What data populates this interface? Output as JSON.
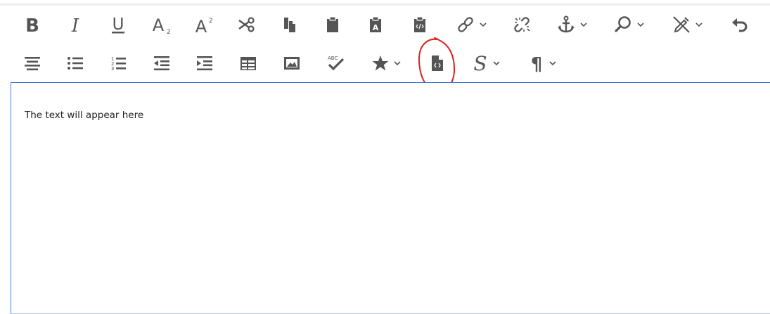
{
  "editor": {
    "content": "The text will appear here"
  },
  "toolbar": {
    "row1": [
      {
        "name": "bold-icon",
        "glyph": "B"
      },
      {
        "name": "italic-icon",
        "glyph": "I"
      },
      {
        "name": "underline-icon",
        "glyph": "U"
      },
      {
        "name": "subscript-icon",
        "glyph": "A"
      },
      {
        "name": "superscript-icon",
        "glyph": "A"
      },
      {
        "name": "cut-icon"
      },
      {
        "name": "copy-icon"
      },
      {
        "name": "paste-icon"
      },
      {
        "name": "paste-text-icon",
        "glyph": "A"
      },
      {
        "name": "paste-code-icon"
      },
      {
        "name": "link-icon",
        "dropdown": true
      },
      {
        "name": "unlink-icon"
      },
      {
        "name": "anchor-icon",
        "dropdown": true
      },
      {
        "name": "find-icon",
        "dropdown": true
      },
      {
        "name": "no-edit-icon",
        "dropdown": true
      },
      {
        "name": "undo-icon"
      }
    ],
    "row2": [
      {
        "name": "align-icon"
      },
      {
        "name": "bullet-list-icon"
      },
      {
        "name": "numbered-list-icon"
      },
      {
        "name": "outdent-icon"
      },
      {
        "name": "indent-icon"
      },
      {
        "name": "table-icon"
      },
      {
        "name": "image-icon"
      },
      {
        "name": "spellcheck-icon",
        "glyph": "ABC"
      },
      {
        "name": "star-icon",
        "dropdown": true
      },
      {
        "name": "source-code-icon"
      },
      {
        "name": "style-icon",
        "glyph": "S",
        "dropdown": true
      },
      {
        "name": "paragraph-icon",
        "glyph": "¶",
        "dropdown": true
      }
    ]
  },
  "colors": {
    "icon": "#555555",
    "editor_border": "#3b6fd6",
    "annotation": "#e0201a"
  }
}
